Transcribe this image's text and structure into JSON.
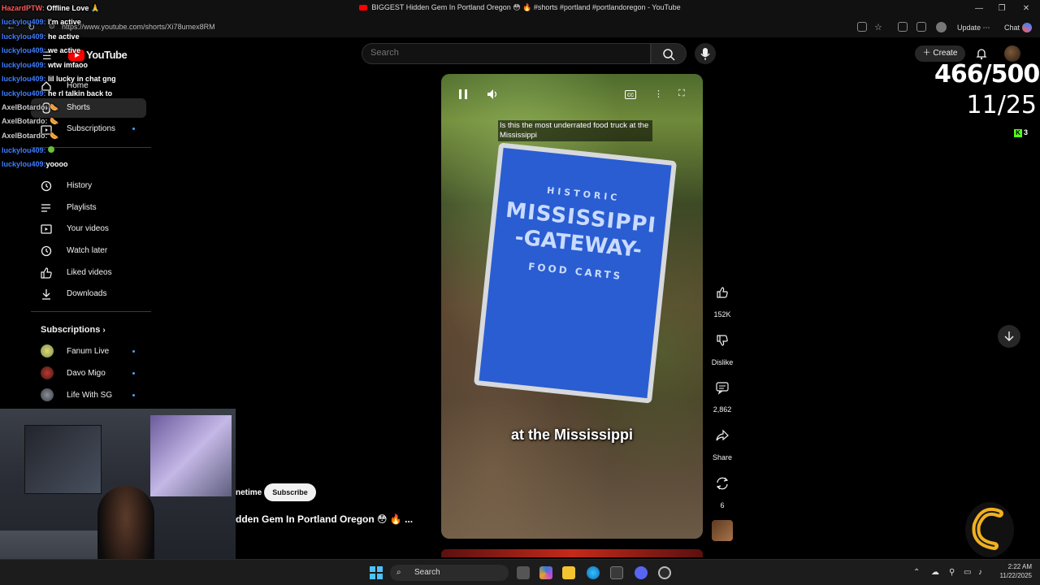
{
  "window": {
    "title": "BIGGEST Hidden Gem In Portland Oregon 😳 🔥 #shorts #portland #portlandoregon - YouTube",
    "url": "https://www.youtube.com/shorts/Xi78umex8RM",
    "update_label": "Update",
    "chat_label": "Chat"
  },
  "header": {
    "logo_text": "YouTube",
    "search_placeholder": "Search",
    "create_label": "Create"
  },
  "sidebar": {
    "items": [
      {
        "label": "Home"
      },
      {
        "label": "Shorts"
      },
      {
        "label": "Subscriptions"
      },
      {
        "label": "History"
      },
      {
        "label": "Playlists"
      },
      {
        "label": "Your videos"
      },
      {
        "label": "Watch later"
      },
      {
        "label": "Liked videos"
      },
      {
        "label": "Downloads"
      }
    ],
    "subs_heading": "Subscriptions",
    "subscriptions": [
      {
        "label": "Fanum Live"
      },
      {
        "label": "Davo Migo"
      },
      {
        "label": "Life With SG"
      }
    ]
  },
  "chat": [
    {
      "user": "HazardPTW:",
      "msg": "Offline Love 🙏"
    },
    {
      "user": "luckylou409:",
      "msg": "I'm active"
    },
    {
      "user": "luckylou409:",
      "msg": "he active"
    },
    {
      "user": "luckylou409:",
      "msg": "we active"
    },
    {
      "user": "luckylou409:",
      "msg": "wtw imfaoo"
    },
    {
      "user": "luckylou409:",
      "msg": "lil lucky in chat gng"
    },
    {
      "user": "luckylou409:",
      "msg": "he rl talkin back to"
    },
    {
      "user": "AxelBotardo:",
      "msg": ""
    },
    {
      "user": "AxelBotardo:",
      "msg": ""
    },
    {
      "user": "AxelBotardo:",
      "msg": ""
    },
    {
      "user": "luckylou409:",
      "msg": ""
    },
    {
      "user": "luckylou409:",
      "msg": "yoooo"
    }
  ],
  "video": {
    "caption_top": "Is this the most underrated food truck at the Mississippi",
    "caption_big": "at the Mississippi",
    "sign_historic": "HISTORIC",
    "sign_line1": "MISSISSIPPI",
    "sign_line2": "-GATEWAY-",
    "sign_line3": "FOOD CARTS"
  },
  "actions": {
    "likes": "152K",
    "dislike_label": "Dislike",
    "comments": "2,862",
    "share_label": "Share",
    "remix": "6"
  },
  "channel": {
    "name": "netime",
    "subscribe_label": "Subscribe",
    "title": "dden Gem In Portland Oregon 😳 🔥 ..."
  },
  "overlay": {
    "counter_main": "466/500",
    "counter_sub": "11/25",
    "kick_viewers": "3"
  },
  "taskbar": {
    "search_label": "Search",
    "time": "2:22 AM",
    "date": "11/22/2025"
  },
  "colors": {
    "yt_red": "#ff0000",
    "chat_user": "#3f7dff",
    "sign_blue": "#2a5dd1",
    "kick_green": "#53fc18"
  }
}
